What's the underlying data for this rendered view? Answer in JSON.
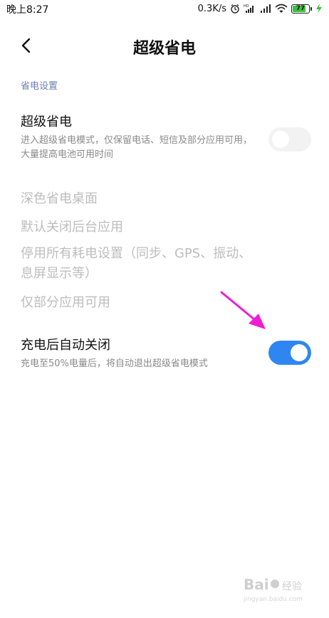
{
  "status_bar": {
    "time": "晚上8:27",
    "network_speed": "0.3K/s",
    "battery_level": "77",
    "icons": [
      "alarm-icon",
      "hd-signal-icon",
      "signal-icon",
      "wifi-icon",
      "battery-icon",
      "charging-icon"
    ]
  },
  "header": {
    "title": "超级省电",
    "back_icon": "back-chevron-icon"
  },
  "section": {
    "title": "省电设置"
  },
  "super_saver": {
    "title": "超级省电",
    "description": "进入超级省电模式，仅保留电话、短信及部分应用可用，大量提高电池可用时间",
    "enabled": false
  },
  "disabled_items": [
    "深色省电桌面",
    "默认关闭后台应用",
    "停用所有耗电设置（同步、GPS、振动、息屏显示等）",
    "仅部分应用可用"
  ],
  "auto_close": {
    "title": "充电后自动关闭",
    "description": "充电至50%电量后，将自动退出超级省电模式",
    "enabled": true
  },
  "watermark": {
    "brand": "Bai du 经验",
    "url": "jingyan.baidu.com"
  },
  "colors": {
    "accent": "#2f86f0",
    "arrow": "#ee1ed4",
    "section_title": "#6b7fb0",
    "charge_green": "#39c23a"
  }
}
